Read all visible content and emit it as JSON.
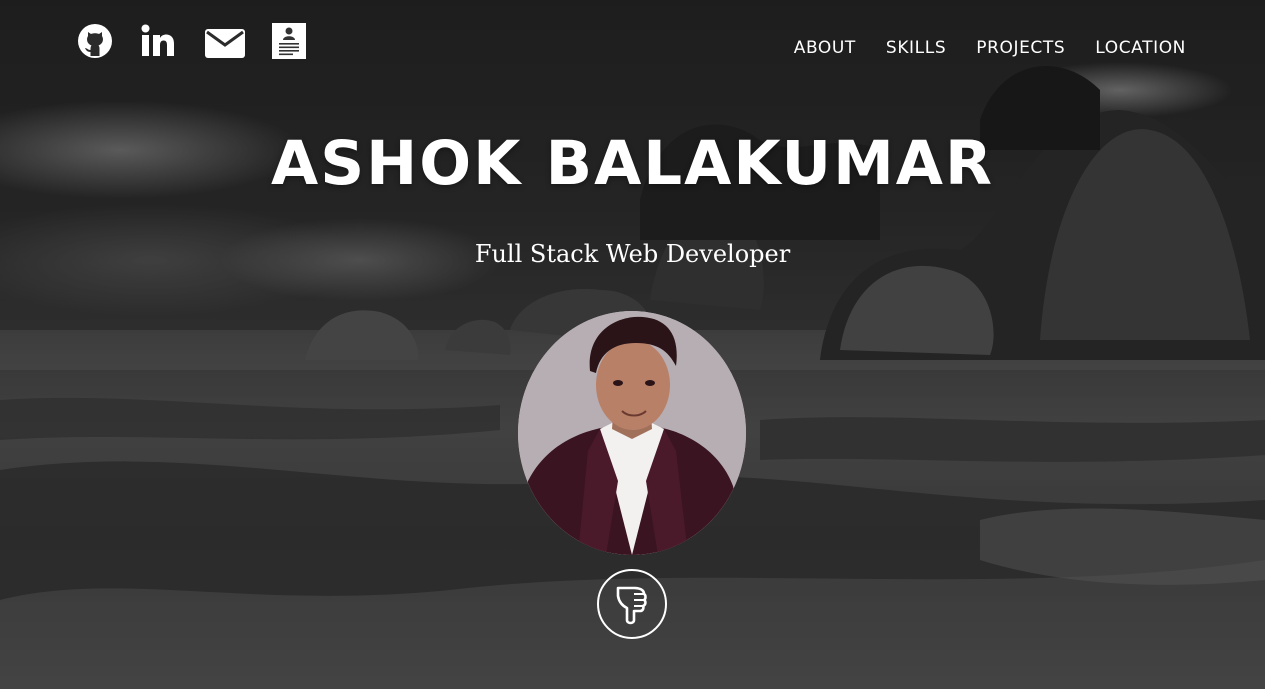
{
  "header": {
    "social": [
      {
        "icon": "github-icon",
        "label": "GitHub"
      },
      {
        "icon": "linkedin-icon",
        "label": "LinkedIn"
      },
      {
        "icon": "envelope-icon",
        "label": "Email"
      },
      {
        "icon": "resume-icon",
        "label": "Resume"
      }
    ],
    "nav": [
      {
        "label": "ABOUT"
      },
      {
        "label": "SKILLS"
      },
      {
        "label": "PROJECTS"
      },
      {
        "label": "LOCATION"
      }
    ]
  },
  "hero": {
    "name": "ASHOK BALAKUMAR",
    "tagline": "Full Stack Web Developer",
    "avatar_icon": "profile-photo",
    "scroll_icon": "pointing-down-hand-icon"
  },
  "colors": {
    "text": "#ffffff",
    "overlay": "#000000"
  }
}
